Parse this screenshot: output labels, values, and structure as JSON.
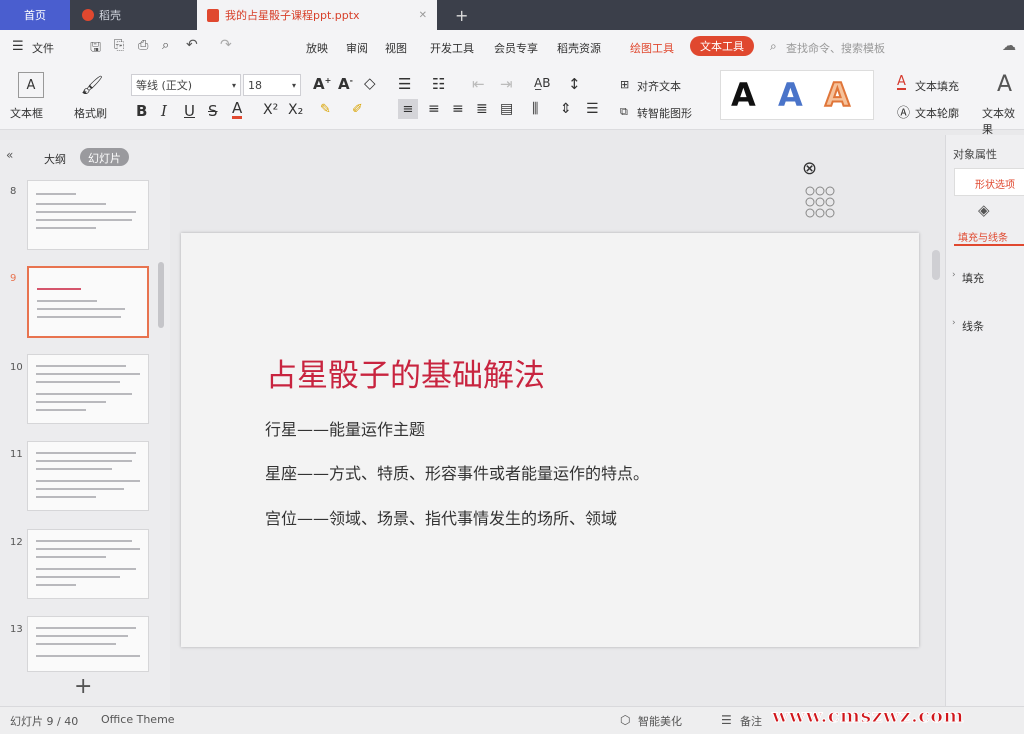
{
  "tabs": [
    {
      "label": "首页"
    },
    {
      "label": "稻壳"
    },
    {
      "label": "我的占星骰子课程ppt.pptx"
    }
  ],
  "menu": {
    "file": "文件",
    "items": [
      "放映",
      "审阅",
      "视图",
      "开发工具",
      "会员专享",
      "稻壳资源"
    ],
    "drawing_tools": "绘图工具",
    "text_tools": "文本工具",
    "search_placeholder": "查找命令、搜索模板"
  },
  "ribbon": {
    "textbox": "文本框",
    "format_painter": "格式刷",
    "font_name": "等线 (正文)",
    "font_size": "18",
    "align_text": "对齐文本",
    "smart_shape": "转智能图形",
    "text_fill": "文本填充",
    "text_outline": "文本轮廓",
    "text_effect": "文本效果",
    "style_letters": [
      "A",
      "A",
      "A"
    ]
  },
  "left_panel": {
    "outline_tab": "大纲",
    "slides_tab": "幻灯片",
    "slide_numbers": [
      "8",
      "9",
      "10",
      "11",
      "12",
      "13"
    ],
    "add": "+"
  },
  "slide": {
    "title": "占星骰子的基础解法",
    "lines": [
      "行星——能量运作主题",
      "星座——方式、特质、形容事件或者能量运作的特点。",
      "宫位——领域、场景、指代事情发生的场所、领域"
    ]
  },
  "right_panel": {
    "title": "对象属性",
    "tab_shape": "形状选项",
    "tab_fill": "填充与线条",
    "fill": "填充",
    "line": "线条"
  },
  "status": {
    "slide_counter": "幻灯片 9 / 40",
    "theme": "Office Theme",
    "smart_beautify": "智能美化",
    "notes": "备注",
    "watermark": "www.cmszwz.com"
  },
  "colors": {
    "accent": "#e0482f",
    "title": "#c8243f",
    "tabbar": "#3b3f4a"
  }
}
